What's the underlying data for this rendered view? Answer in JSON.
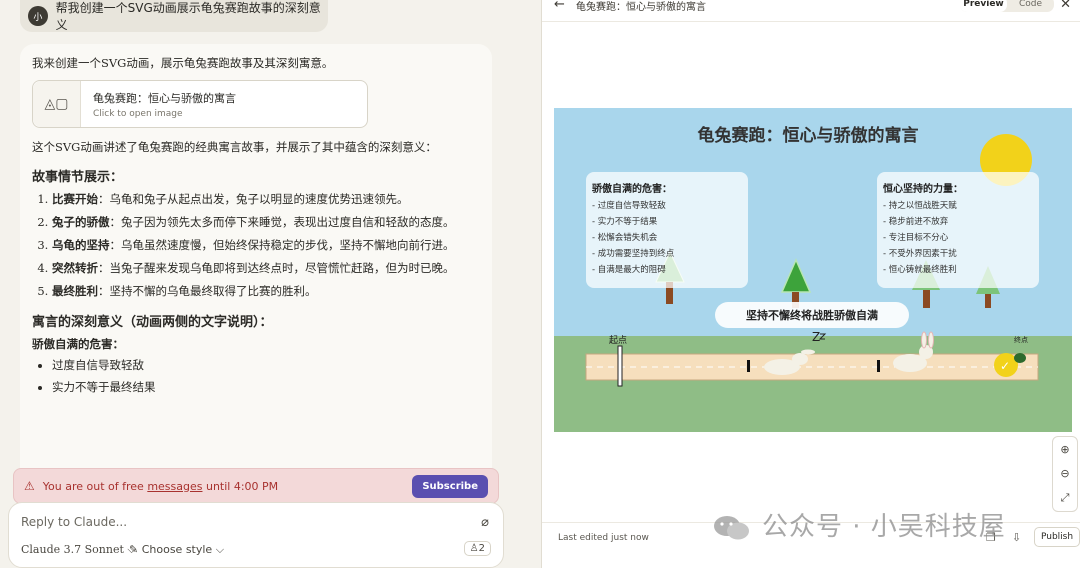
{
  "chat": {
    "user_avatar": "小",
    "user_message": "帮我创建一个SVG动画展示龟兔赛跑故事的深刻意义",
    "reply_intro": "我来创建一个SVG动画，展示龟兔赛跑故事及其深刻寓意。",
    "artifact_title": "龟兔赛跑：恒心与骄傲的寓言",
    "artifact_sub": "Click to open image",
    "reply_desc": "这个SVG动画讲述了龟兔赛跑的经典寓言故事，并展示了其中蕴含的深刻意义：",
    "story_heading": "故事情节展示：",
    "story": [
      {
        "title": "比赛开始",
        "text": "：乌龟和兔子从起点出发，兔子以明显的速度优势迅速领先。"
      },
      {
        "title": "兔子的骄傲",
        "text": "：兔子因为领先太多而停下来睡觉，表现出过度自信和轻敌的态度。"
      },
      {
        "title": "乌龟的坚持",
        "text": "：乌龟虽然速度慢，但始终保持稳定的步伐，坚持不懈地向前行进。"
      },
      {
        "title": "突然转折",
        "text": "：当兔子醒来发现乌龟即将到达终点时，尽管慌忙赶路，但为时已晚。"
      },
      {
        "title": "最终胜利",
        "text": "：坚持不懈的乌龟最终取得了比赛的胜利。"
      }
    ],
    "meaning_heading": "寓言的深刻意义（动画两侧的文字说明）：",
    "pride_heading": "骄傲自满的危害：",
    "pride_items": [
      "过度自信导致轻敌",
      "实力不等于最终结果"
    ],
    "banner_text_pre": "You are out of free ",
    "banner_link": "messages",
    "banner_text_post": " until 4:00 PM",
    "subscribe_label": "Subscribe",
    "composer_placeholder": "Reply to Claude...",
    "model_label": "Claude 3.7 Sonnet ⌵",
    "style_label": "Choose style ⌵",
    "badge_label": "2"
  },
  "panel": {
    "title": "龟兔赛跑：恒心与骄傲的寓言",
    "preview_label": "Preview",
    "code_label": "Code",
    "footer_text": "Last edited just now",
    "publish_label": "Publish"
  },
  "svg": {
    "title": "龟兔赛跑：恒心与骄傲的寓言",
    "left_heading": "骄傲自满的危害：",
    "left_items": [
      "- 过度自信导致轻敌",
      "- 实力不等于结果",
      "- 松懈会错失机会",
      "- 成功需要坚持到终点",
      "- 自满是最大的阻碍"
    ],
    "right_heading": "恒心坚持的力量：",
    "right_items": [
      "- 持之以恒战胜天赋",
      "- 稳步前进不放弃",
      "- 专注目标不分心",
      "- 不受外界因素干扰",
      "- 恒心铸就最终胜利"
    ],
    "motto": "坚持不懈终将战胜骄傲自满",
    "start_label": "起点",
    "zzz_label": "Z",
    "check_label": "✓",
    "finish_label": "终点"
  },
  "watermark": {
    "text": "公众号 · 小吴科技屋"
  },
  "colors": {
    "subscribe_bg": "#5a4fb0",
    "banner_bg": "#f3d9d9",
    "sky": "#a9d6ec",
    "grass": "#8fbd86",
    "sun": "#f2d21a"
  }
}
